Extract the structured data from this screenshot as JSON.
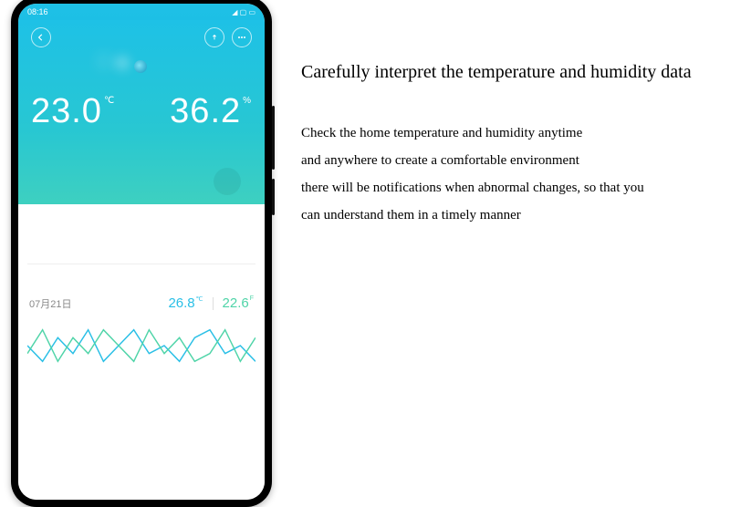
{
  "status_bar": {
    "time": "08:16",
    "icons": "◢ ▢ ▭"
  },
  "hero": {
    "temperature_value": "23.0",
    "temperature_unit": "℃",
    "humidity_value": "36.2",
    "humidity_unit": "%"
  },
  "row2": {
    "date": "07月21日",
    "temperature": "26.8",
    "temperature_unit": "℃",
    "humidity": "22.6",
    "humidity_unit": "F"
  },
  "marketing": {
    "headline": "Carefully interpret the temperature and humidity data",
    "line1": "Check the home temperature and humidity anytime",
    "line2": "and anywhere to create a comfortable environment",
    "line3": "there will be notifications when abnormal changes, so that you",
    "line4": "can understand them in a timely manner"
  },
  "chart_data": {
    "type": "line",
    "title": "",
    "xlabel": "",
    "ylabel": "",
    "series": [
      {
        "name": "temperature",
        "color": "#29bfe6",
        "values": [
          26,
          22,
          28,
          24,
          30,
          22,
          26,
          30,
          24,
          26,
          22,
          28,
          30,
          24,
          26,
          22
        ]
      },
      {
        "name": "humidity",
        "color": "#4fd4a8",
        "values": [
          24,
          30,
          22,
          28,
          24,
          30,
          26,
          22,
          30,
          24,
          28,
          22,
          24,
          30,
          22,
          28
        ]
      }
    ],
    "ylim": [
      20,
      32
    ]
  }
}
